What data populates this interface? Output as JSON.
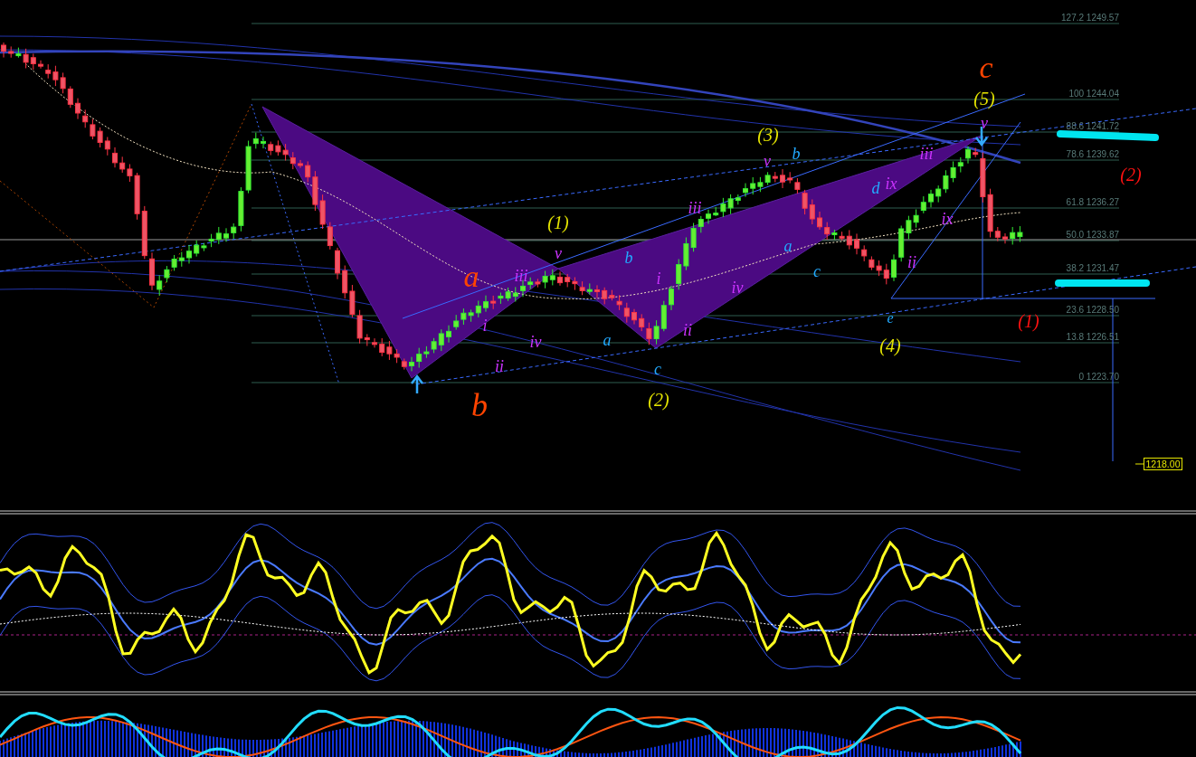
{
  "fib_levels": [
    {
      "label": "127.2 1249.57"
    },
    {
      "label": "100 1244.04"
    },
    {
      "label": "88.6 1241.72"
    },
    {
      "label": "78.6 1239.62"
    },
    {
      "label": "61.8 1236.27"
    },
    {
      "label": "50.0 1233.87"
    },
    {
      "label": "38.2 1231.47"
    },
    {
      "label": "23.6 1228.50"
    },
    {
      "label": "13.8 1226.51"
    },
    {
      "label": "0 1223.70"
    }
  ],
  "wave_labels": [
    {
      "text": "c",
      "color": "#ff4400"
    },
    {
      "text": "(5)",
      "color": "#e6e600"
    },
    {
      "text": "v",
      "color": "#cc33ff"
    },
    {
      "text": "(3)",
      "color": "#e6e600"
    },
    {
      "text": "v",
      "color": "#cc33ff"
    },
    {
      "text": "b",
      "color": "#22aaff"
    },
    {
      "text": "iii",
      "color": "#cc33ff"
    },
    {
      "text": "(2)",
      "color": "#ff1111"
    },
    {
      "text": "d",
      "color": "#22aaff"
    },
    {
      "text": "ix",
      "color": "#cc33ff"
    },
    {
      "text": "iii",
      "color": "#cc33ff"
    },
    {
      "text": "ix",
      "color": "#cc33ff"
    },
    {
      "text": "(1)",
      "color": "#e6e600"
    },
    {
      "text": "a",
      "color": "#22aaff"
    },
    {
      "text": "v",
      "color": "#cc33ff"
    },
    {
      "text": "b",
      "color": "#22aaff"
    },
    {
      "text": "ii",
      "color": "#cc33ff"
    },
    {
      "text": "a",
      "color": "#ff4400"
    },
    {
      "text": "iii",
      "color": "#cc33ff"
    },
    {
      "text": "i",
      "color": "#cc33ff"
    },
    {
      "text": "iv",
      "color": "#cc33ff"
    },
    {
      "text": "c",
      "color": "#22aaff"
    },
    {
      "text": "e",
      "color": "#22aaff"
    },
    {
      "text": "i",
      "color": "#cc33ff"
    },
    {
      "text": "iv",
      "color": "#cc33ff"
    },
    {
      "text": "a",
      "color": "#22aaff"
    },
    {
      "text": "ii",
      "color": "#cc33ff"
    },
    {
      "text": "(1)",
      "color": "#ff1111"
    },
    {
      "text": "(4)",
      "color": "#e6e600"
    },
    {
      "text": "ii",
      "color": "#cc33ff"
    },
    {
      "text": "c",
      "color": "#22aaff"
    },
    {
      "text": "b",
      "color": "#ff4400"
    },
    {
      "text": "(2)",
      "color": "#e6e600"
    }
  ],
  "price_tag": "1218.00"
}
